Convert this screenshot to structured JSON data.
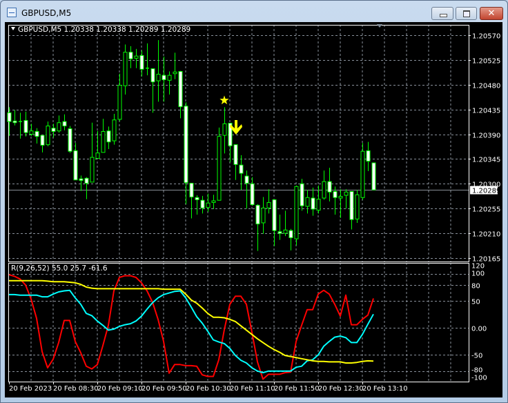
{
  "window": {
    "title": "GBPUSD,M5",
    "buttons": {
      "minimize": "minimize",
      "maximize": "maximize",
      "close": "✕"
    }
  },
  "chart": {
    "symbol_header": "GBPUSD,M5  1.20338 1.20338 1.20289 1.20289",
    "current_price": "1.20289",
    "colors": {
      "background": "#000000",
      "grid": "#8a929c",
      "candle_outline": "#00ff00",
      "bear_body": "#ffffff",
      "bull_body": "#000000",
      "axis_text": "#ffffff",
      "marker": "#ffff00"
    },
    "price_labels": [
      "1.20570",
      "1.20525",
      "1.20480",
      "1.20435",
      "1.20390",
      "1.20345",
      "1.20300",
      "1.20255",
      "1.20210",
      "1.20165"
    ],
    "time_labels": [
      "20 Feb 2023",
      "20 Feb 08:30",
      "20 Feb 09:10",
      "20 Feb 09:50",
      "20 Feb 10:30",
      "20 Feb 11:10",
      "20 Feb 11:50",
      "20 Feb 12:30",
      "20 Feb 13:10"
    ],
    "markers": [
      {
        "type": "star-icon",
        "candle": 39
      },
      {
        "type": "down-arrow-icon",
        "candle": 41
      }
    ]
  },
  "chart_data": [
    {
      "type": "candlestick",
      "title": "GBPUSD,M5",
      "ylim": [
        1.20165,
        1.2057
      ],
      "grid": true,
      "fields": [
        "open",
        "high",
        "low",
        "close"
      ],
      "candles": [
        [
          1.20429,
          1.20439,
          1.20387,
          1.20413
        ],
        [
          1.20414,
          1.20434,
          1.20406,
          1.20411
        ],
        [
          1.20413,
          1.20429,
          1.20382,
          1.20413
        ],
        [
          1.20415,
          1.20431,
          1.20386,
          1.20393
        ],
        [
          1.2039,
          1.20409,
          1.20387,
          1.20396
        ],
        [
          1.20395,
          1.20401,
          1.20373,
          1.20386
        ],
        [
          1.20388,
          1.20388,
          1.20357,
          1.2037
        ],
        [
          1.20371,
          1.20413,
          1.20368,
          1.20405
        ],
        [
          1.20401,
          1.20409,
          1.20384,
          1.20395
        ],
        [
          1.20396,
          1.20424,
          1.20393,
          1.20411
        ],
        [
          1.20413,
          1.20426,
          1.20397,
          1.20405
        ],
        [
          1.204,
          1.20405,
          1.20356,
          1.20359
        ],
        [
          1.2036,
          1.20374,
          1.20307,
          1.20307
        ],
        [
          1.20309,
          1.20315,
          1.20287,
          1.20306
        ],
        [
          1.2031,
          1.20312,
          1.20272,
          1.20301
        ],
        [
          1.20303,
          1.20411,
          1.20303,
          1.20348
        ],
        [
          1.20346,
          1.20396,
          1.20346,
          1.20356
        ],
        [
          1.20357,
          1.20418,
          1.20357,
          1.20395
        ],
        [
          1.20396,
          1.20404,
          1.20363,
          1.20376
        ],
        [
          1.20378,
          1.20427,
          1.20371,
          1.20416
        ],
        [
          1.20417,
          1.205,
          1.20414,
          1.20479
        ],
        [
          1.20478,
          1.20553,
          1.20462,
          1.20539
        ],
        [
          1.20539,
          1.2055,
          1.2051,
          1.20527
        ],
        [
          1.20528,
          1.20545,
          1.2051,
          1.20532
        ],
        [
          1.20533,
          1.20542,
          1.20495,
          1.20508
        ],
        [
          1.2051,
          1.20555,
          1.20497,
          1.2051
        ],
        [
          1.20509,
          1.20509,
          1.20429,
          1.20485
        ],
        [
          1.20487,
          1.20561,
          1.20449,
          1.20499
        ],
        [
          1.20497,
          1.20531,
          1.20449,
          1.20489
        ],
        [
          1.20488,
          1.20504,
          1.20462,
          1.20497
        ],
        [
          1.205,
          1.20538,
          1.2049,
          1.20503
        ],
        [
          1.20504,
          1.20505,
          1.20419,
          1.2044
        ],
        [
          1.20441,
          1.20448,
          1.20263,
          1.20302
        ],
        [
          1.20301,
          1.20301,
          1.20237,
          1.20276
        ],
        [
          1.20275,
          1.20279,
          1.20244,
          1.20271
        ],
        [
          1.2027,
          1.20278,
          1.20246,
          1.20256
        ],
        [
          1.20257,
          1.20282,
          1.20249,
          1.20265
        ],
        [
          1.20266,
          1.2028,
          1.20254,
          1.20269
        ],
        [
          1.2027,
          1.20402,
          1.2027,
          1.20386
        ],
        [
          1.20388,
          1.20439,
          1.20355,
          1.20409
        ],
        [
          1.2041,
          1.2041,
          1.20339,
          1.20369
        ],
        [
          1.20371,
          1.20371,
          1.20307,
          1.20335
        ],
        [
          1.20334,
          1.20352,
          1.20289,
          1.20319
        ],
        [
          1.20314,
          1.20324,
          1.20255,
          1.20301
        ],
        [
          1.203,
          1.20312,
          1.2026,
          1.20262
        ],
        [
          1.20261,
          1.20263,
          1.20178,
          1.20227
        ],
        [
          1.20229,
          1.20276,
          1.20209,
          1.20256
        ],
        [
          1.20256,
          1.2029,
          1.20246,
          1.20266
        ],
        [
          1.20271,
          1.20271,
          1.20187,
          1.20215
        ],
        [
          1.20213,
          1.20244,
          1.20198,
          1.2021
        ],
        [
          1.2021,
          1.20251,
          1.20205,
          1.20216
        ],
        [
          1.20215,
          1.20218,
          1.20179,
          1.20202
        ],
        [
          1.202,
          1.20297,
          1.20188,
          1.20295
        ],
        [
          1.203,
          1.20309,
          1.20251,
          1.2026
        ],
        [
          1.20259,
          1.20289,
          1.20246,
          1.20275
        ],
        [
          1.20274,
          1.20293,
          1.20242,
          1.20254
        ],
        [
          1.20252,
          1.20297,
          1.20246,
          1.20272
        ],
        [
          1.20274,
          1.20324,
          1.20271,
          1.20304
        ],
        [
          1.20304,
          1.20329,
          1.20268,
          1.20285
        ],
        [
          1.20286,
          1.20295,
          1.20244,
          1.20275
        ],
        [
          1.20274,
          1.2029,
          1.20238,
          1.20277
        ],
        [
          1.20279,
          1.2029,
          1.20255,
          1.20285
        ],
        [
          1.20286,
          1.20286,
          1.20217,
          1.20235
        ],
        [
          1.20236,
          1.20289,
          1.20229,
          1.2028
        ],
        [
          1.20275,
          1.20374,
          1.20271,
          1.20359
        ],
        [
          1.2036,
          1.20376,
          1.20323,
          1.20341
        ],
        [
          1.20338,
          1.20338,
          1.20289,
          1.20289
        ]
      ]
    },
    {
      "type": "line",
      "title": "R(9,26,52) 55.0 25.7 -61.6",
      "ylim": [
        -100,
        120
      ],
      "grid": true,
      "ytick_labels": [
        "120",
        "100",
        "80",
        "50",
        "0.00",
        "-50",
        "-80",
        "-100"
      ],
      "yticks": [
        120,
        100,
        80,
        50,
        0,
        -50,
        -80,
        -100
      ],
      "series": [
        {
          "color": "#ff0000",
          "values": [
            99,
            96,
            91,
            80,
            54,
            18,
            -44,
            -74,
            -58,
            -27,
            14,
            14,
            -25,
            -46,
            -71,
            -76,
            -68,
            -33,
            5,
            69,
            94,
            97,
            97,
            94,
            84,
            69,
            48,
            16,
            -25,
            -84,
            -68,
            -68,
            -70,
            -70,
            -71,
            -87,
            -90,
            -90,
            -59,
            -3,
            44,
            59,
            59,
            44,
            -8,
            -63,
            -95,
            -86,
            -86,
            -86,
            -83,
            -82,
            -25,
            5,
            34,
            34,
            63,
            70,
            63,
            44,
            22,
            61,
            6,
            6,
            16,
            24,
            55.0
          ]
        },
        {
          "color": "#00ffff",
          "values": [
            62,
            62,
            61,
            61,
            61,
            61,
            58,
            58,
            63,
            67,
            69,
            70,
            56,
            44,
            27,
            23,
            13,
            5,
            -4,
            -2,
            3,
            6,
            8,
            13,
            22,
            35,
            47,
            56,
            62,
            65,
            68,
            69,
            56,
            39,
            21,
            9,
            -6,
            -22,
            -26,
            -29,
            -38,
            -51,
            -60,
            -65,
            -74,
            -80,
            -83,
            -80,
            -80,
            -80,
            -80,
            -80,
            -73,
            -71,
            -61,
            -59,
            -50,
            -34,
            -25,
            -17,
            -15,
            -18,
            -27,
            -27,
            -12,
            7,
            25.7
          ]
        },
        {
          "color": "#ffff00",
          "values": [
            88,
            88,
            88,
            88,
            88,
            88,
            88,
            87,
            86,
            86,
            86,
            85,
            84,
            81,
            76,
            74,
            73,
            73,
            73,
            73,
            73,
            73,
            73,
            73,
            73,
            73,
            73,
            73,
            72,
            72,
            72,
            72,
            63,
            52,
            46,
            37,
            27,
            20,
            20,
            19,
            16,
            12,
            4,
            -4,
            -12,
            -20,
            -27,
            -34,
            -40,
            -45,
            -51,
            -53,
            -55,
            -57,
            -59,
            -61,
            -62,
            -62,
            -63,
            -63,
            -63,
            -65,
            -65,
            -64,
            -62,
            -61,
            -61.6
          ]
        }
      ]
    }
  ]
}
